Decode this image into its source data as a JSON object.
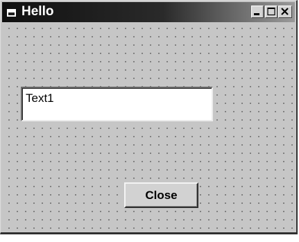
{
  "window": {
    "title": "Hello"
  },
  "title_bar_buttons": {
    "minimize_icon": "minimize-icon",
    "maximize_icon": "maximize-icon",
    "close_icon": "close-icon"
  },
  "form": {
    "textbox_value": "Text1",
    "close_button_label": "Close"
  },
  "colors": {
    "titlebar_start": "#101010",
    "titlebar_end": "#9a9a9a",
    "form_background": "#c6c6c6",
    "grid_dot": "#6e6e6e"
  }
}
